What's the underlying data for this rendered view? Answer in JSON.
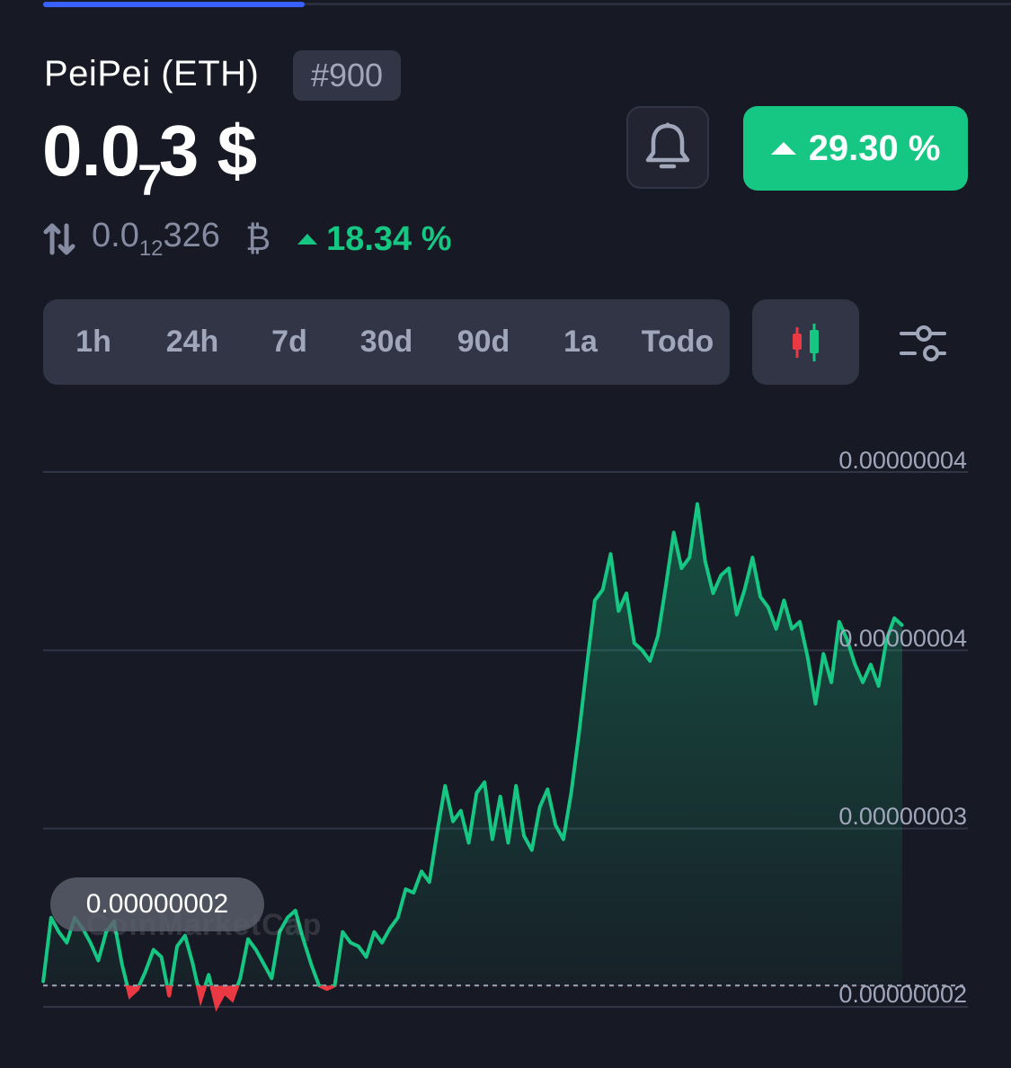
{
  "header": {
    "coin_name": "PeiPei (ETH)",
    "rank": "#900",
    "price_main": "0.0",
    "price_zeros": "7",
    "price_tail": "3 $",
    "change_24h": "29.30 %",
    "btc_price_prefix": "0.0",
    "btc_price_zeros": "12",
    "btc_price_tail": "326",
    "btc_symbol": "₿",
    "btc_change": "18.34 %"
  },
  "colors": {
    "background": "#171924",
    "up": "#16c784",
    "down": "#ea3943",
    "accent": "#3861fb",
    "muted_text": "#a1a7bb"
  },
  "icons": {
    "alert": "bell-icon",
    "convert": "swap-arrows-icon",
    "chart_type": "candlestick-icon",
    "settings": "sliders-icon"
  },
  "top_progress_fraction": 0.27,
  "time_tabs": {
    "items": [
      "1h",
      "24h",
      "7d",
      "30d",
      "90d",
      "1a",
      "Todo"
    ],
    "active": "7d"
  },
  "chart": {
    "current_label": "0.00000002",
    "watermark": "CoinMarketCap"
  },
  "chart_data": {
    "type": "area",
    "title": "",
    "xlabel": "",
    "ylabel": "",
    "y_tick_labels": [
      "0.00000004",
      "0.00000004",
      "0.00000003",
      "0.00000002"
    ],
    "y_ticks": [
      4e-08,
      3.5e-08,
      3e-08,
      2.5e-08
    ],
    "ylim": [
      2.45e-08,
      4.05e-08
    ],
    "baseline": 2.56e-08,
    "grid": true,
    "series": [
      {
        "values": [
          2.57e-08,
          2.75e-08,
          2.71e-08,
          2.68e-08,
          2.75e-08,
          2.72e-08,
          2.68e-08,
          2.63e-08,
          2.71e-08,
          2.74e-08,
          2.62e-08,
          2.53e-08,
          2.55e-08,
          2.6e-08,
          2.66e-08,
          2.64e-08,
          2.53e-08,
          2.67e-08,
          2.7e-08,
          2.62e-08,
          2.52e-08,
          2.59e-08,
          2.5e-08,
          2.54e-08,
          2.52e-08,
          2.58e-08,
          2.69e-08,
          2.66e-08,
          2.62e-08,
          2.58e-08,
          2.71e-08,
          2.75e-08,
          2.77e-08,
          2.69e-08,
          2.62e-08,
          2.56e-08,
          2.55e-08,
          2.56e-08,
          2.71e-08,
          2.68e-08,
          2.67e-08,
          2.64e-08,
          2.71e-08,
          2.68e-08,
          2.72e-08,
          2.75e-08,
          2.83e-08,
          2.82e-08,
          2.88e-08,
          2.85e-08,
          2.99e-08,
          3.12e-08,
          3.02e-08,
          3.05e-08,
          2.96e-08,
          3.1e-08,
          3.13e-08,
          2.97e-08,
          3.09e-08,
          2.96e-08,
          3.12e-08,
          2.98e-08,
          2.94e-08,
          3.06e-08,
          3.11e-08,
          3.01e-08,
          2.97e-08,
          3.1e-08,
          3.27e-08,
          3.46e-08,
          3.64e-08,
          3.67e-08,
          3.77e-08,
          3.61e-08,
          3.66e-08,
          3.52e-08,
          3.5e-08,
          3.47e-08,
          3.54e-08,
          3.68e-08,
          3.83e-08,
          3.73e-08,
          3.76e-08,
          3.91e-08,
          3.75e-08,
          3.66e-08,
          3.71e-08,
          3.73e-08,
          3.6e-08,
          3.67e-08,
          3.76e-08,
          3.65e-08,
          3.62e-08,
          3.56e-08,
          3.64e-08,
          3.56e-08,
          3.58e-08,
          3.48e-08,
          3.35e-08,
          3.49e-08,
          3.41e-08,
          3.58e-08,
          3.53e-08,
          3.46e-08,
          3.41e-08,
          3.46e-08,
          3.4e-08,
          3.53e-08,
          3.59e-08,
          3.57e-08
        ]
      }
    ]
  }
}
